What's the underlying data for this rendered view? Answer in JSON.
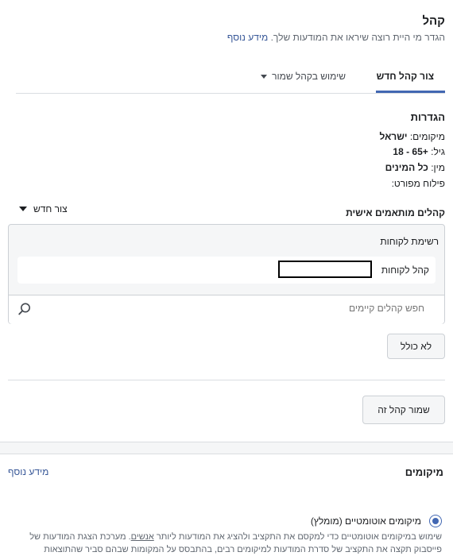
{
  "audience": {
    "title": "קהל",
    "subtitle": "הגדר מי היית רוצה שיראו את המודעות שלך.",
    "learn_more": "מידע נוסף"
  },
  "tabs": [
    {
      "label": "צור קהל חדש",
      "active": true
    },
    {
      "label": "שימוש בקהל שמור",
      "active": false
    }
  ],
  "settings": {
    "heading": "הגדרות",
    "locations_label": "מיקומים:",
    "locations_value": "ישראל",
    "age_label": "גיל:",
    "age_value": "18 - 65+",
    "gender_label": "מין:",
    "gender_value": "כל המינים",
    "detailed": "פילוח מפורט:"
  },
  "custom_audiences": {
    "heading": "קהלים מותאמים אישית",
    "create_new": "צור חדש",
    "section_label": "רשימת לקוחות",
    "selected_label": "קהל לקוחות",
    "search_placeholder": "חפש קהלים קיימים",
    "exclude_button": "לא כולל"
  },
  "save_button": "שמור קהל זה",
  "placements": {
    "heading": "מיקומים",
    "learn_more": "מידע נוסף",
    "auto_label": "מיקומים אוטומטיים (מומלץ)",
    "auto_selected": true,
    "desc_part1": "שימוש במיקומים אוטומטיים כדי למקסם את התקציב ולהציג את המודעות ליותר ",
    "desc_link": "אנשים",
    "desc_part2": ". מערכת הצגת המודעות של פייסבוק תקצה את התקציב של סדרת המודעות למיקומים רבים, בהתבסס על המקומות שבהם סביר שהתוצאות"
  },
  "colors": {
    "accent": "#4267b2",
    "link": "#385898"
  }
}
